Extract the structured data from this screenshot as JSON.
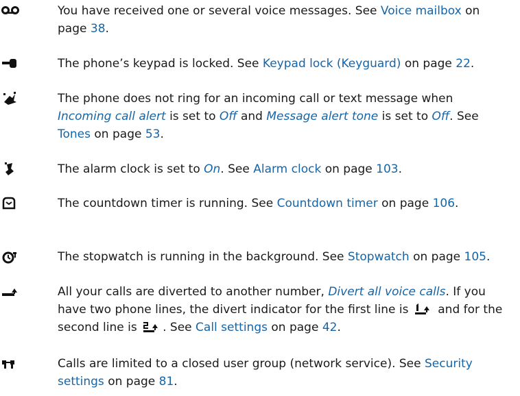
{
  "entries": [
    {
      "icon": "voice-message-icon",
      "parts": [
        {
          "t": "You have received one or several voice messages. See "
        },
        {
          "t": "Voice mailbox",
          "link": true
        },
        {
          "t": " on page "
        },
        {
          "t": "38",
          "link": true
        },
        {
          "t": "."
        }
      ]
    },
    {
      "icon": "keypad-lock-icon",
      "parts": [
        {
          "t": "The phone’s keypad is locked. See "
        },
        {
          "t": "Keypad lock (Keyguard)",
          "link": true
        },
        {
          "t": " on page "
        },
        {
          "t": "22",
          "link": true
        },
        {
          "t": "."
        }
      ]
    },
    {
      "icon": "silent-icon",
      "parts": [
        {
          "t": "The phone does not ring for an incoming call or text message when "
        },
        {
          "t": "Incoming call alert",
          "opt": true
        },
        {
          "t": " is set to "
        },
        {
          "t": "Off",
          "opt": true
        },
        {
          "t": " and "
        },
        {
          "t": "Message alert tone",
          "opt": true
        },
        {
          "t": " is set to "
        },
        {
          "t": "Off",
          "opt": true
        },
        {
          "t": ". See "
        },
        {
          "t": "Tones",
          "link": true
        },
        {
          "t": " on page "
        },
        {
          "t": "53",
          "link": true
        },
        {
          "t": "."
        }
      ]
    },
    {
      "icon": "alarm-clock-icon",
      "parts": [
        {
          "t": "The alarm clock is set to "
        },
        {
          "t": "On",
          "opt": true
        },
        {
          "t": ". See "
        },
        {
          "t": "Alarm clock",
          "link": true
        },
        {
          "t": " on page "
        },
        {
          "t": "103",
          "link": true
        },
        {
          "t": "."
        }
      ]
    },
    {
      "icon": "countdown-timer-icon",
      "parts": [
        {
          "t": "The countdown timer is running. See "
        },
        {
          "t": "Countdown timer",
          "link": true
        },
        {
          "t": " on page "
        },
        {
          "t": "106",
          "link": true
        },
        {
          "t": "."
        }
      ]
    },
    {
      "icon": "stopwatch-icon",
      "parts": [
        {
          "t": "The stopwatch is running in the background. See "
        },
        {
          "t": "Stopwatch",
          "link": true
        },
        {
          "t": " on page "
        },
        {
          "t": "105",
          "link": true
        },
        {
          "t": "."
        }
      ]
    },
    {
      "icon": "divert-icon",
      "parts": [
        {
          "t": "All your calls are diverted to another number, "
        },
        {
          "t": "Divert all voice calls",
          "opt": true
        },
        {
          "t": ". If you have two phone lines, the divert indicator for the first line is "
        },
        {
          "inline_icon": "divert-line-1-icon"
        },
        {
          "t": " and for the second line is "
        },
        {
          "inline_icon": "divert-line-2-icon"
        },
        {
          "t": ". See "
        },
        {
          "t": "Call settings",
          "link": true
        },
        {
          "t": " on page "
        },
        {
          "t": "42",
          "link": true
        },
        {
          "t": "."
        }
      ]
    },
    {
      "icon": "closed-user-group-icon",
      "parts": [
        {
          "t": "Calls are limited to a closed user group (network service). See "
        },
        {
          "t": "Security settings",
          "link": true
        },
        {
          "t": " on page "
        },
        {
          "t": "81",
          "link": true
        },
        {
          "t": "."
        }
      ]
    }
  ],
  "colors": {
    "text": "#1a1a1a",
    "link": "#1565a8",
    "icon": "#111111"
  }
}
